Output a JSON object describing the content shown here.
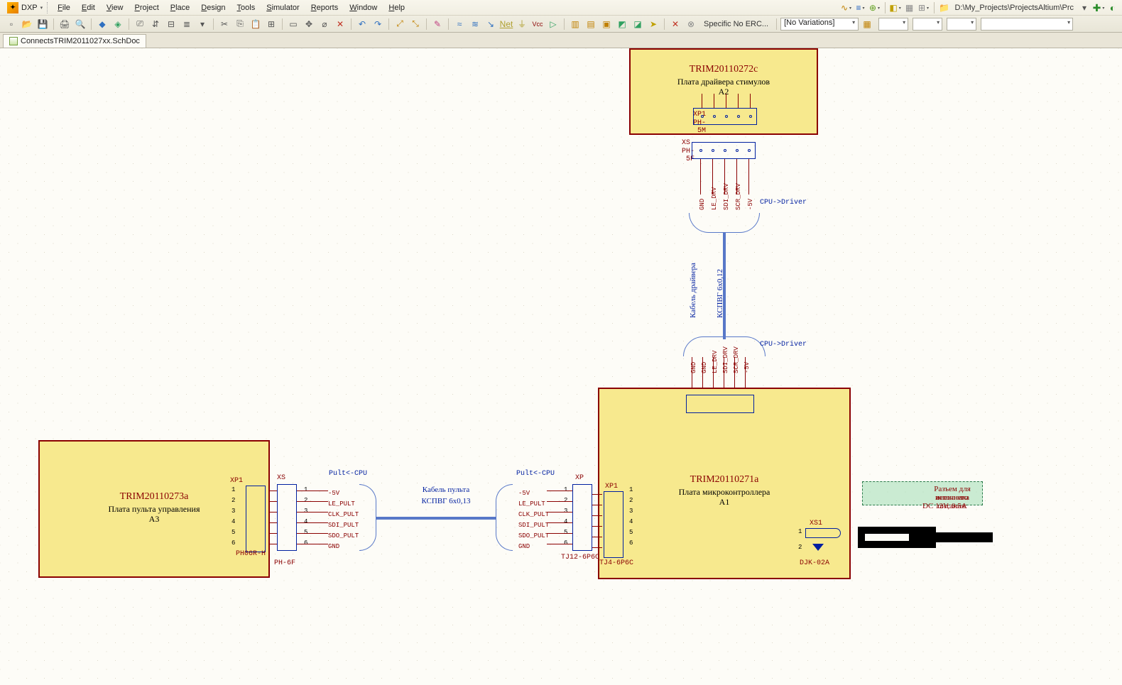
{
  "app": {
    "dxp_label": "DXP",
    "menu": [
      "File",
      "Edit",
      "View",
      "Project",
      "Place",
      "Design",
      "Tools",
      "Simulator",
      "Reports",
      "Window",
      "Help"
    ],
    "path": "D:\\My_Projects\\ProjectsAltium\\Prc",
    "noerc_label": "Specific No ERC...",
    "variations_label": "[No Variations]",
    "tab_name": "ConnectsTRIM2011027xx.SchDoc"
  },
  "schematic": {
    "block_a3": {
      "title": "TRIM20110273a",
      "sub": "Плата пульта управления",
      "ref": "A3",
      "xp": "XP1",
      "conn": "PH06R-H"
    },
    "block_a2": {
      "title": "TRIM20110272c",
      "sub": "Плата драйвера стимулов",
      "ref": "A2",
      "xp": "XP1",
      "conn": "PH-5M"
    },
    "block_a1": {
      "title": "TRIM20110271a",
      "sub": "Плата микроконтроллера",
      "ref": "A1"
    },
    "xs_ph5f": {
      "name": "XS",
      "type": "PH-5F"
    },
    "xs_ph6f": {
      "name": "XS",
      "type": "PH-6F"
    },
    "xp_mid": {
      "name": "XP",
      "type": "TJ12-6P6C"
    },
    "xp1_right": {
      "name": "XP1",
      "type": "TJ4-6P6C"
    },
    "pult_label": "Pult<-CPU",
    "cpu_driver_label": "CPU->Driver",
    "cable_pult": {
      "l1": "Кабель пульта",
      "l2": "КСПВГ 6x0,13"
    },
    "cable_drv": {
      "l1": "Кабель драйвера",
      "l2": "КСПВГ 6x0,12"
    },
    "nets6": [
      "-5V",
      "LE_PULT",
      "CLK_PULT",
      "SDI_PULT",
      "SDO_PULT",
      "GND"
    ],
    "nets5_top": [
      "GND",
      "LE_DRV",
      "SDI_DRV",
      "SCR_DRV",
      "-5V"
    ],
    "nets6_bot": [
      "GND",
      "GND",
      "LE_DRV",
      "SDI_DRV",
      "SCR_DRV",
      "-5V"
    ],
    "xs1": {
      "name": "XS1",
      "type": "DJK-02A"
    },
    "annot": {
      "l1": "Разъем для внешнего",
      "l2": "источника питания:",
      "l3": "DC 12V, 0.5A"
    }
  }
}
